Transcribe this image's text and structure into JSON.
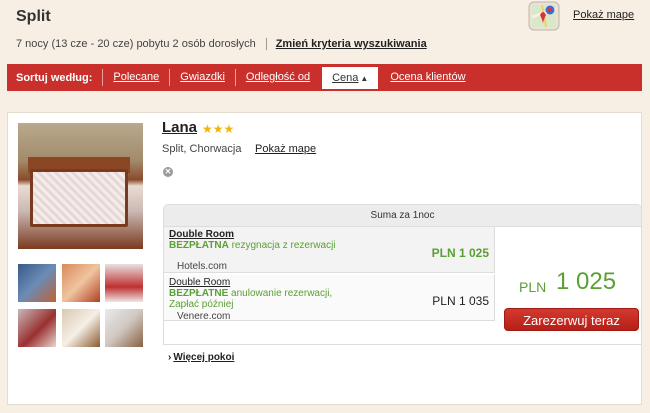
{
  "header": {
    "city": "Split",
    "map_link": "Pokaż mape",
    "search_summary": "7 nocy (13 cze - 20 cze) pobytu 2 osób dorosłych",
    "change_criteria": "Zmień kryteria wyszukiwania"
  },
  "sortbar": {
    "label": "Sortuj według:",
    "items": [
      {
        "label": "Polecane"
      },
      {
        "label": "Gwiazdki"
      },
      {
        "label": "Odległość od"
      },
      {
        "label": "Cena",
        "active": true
      },
      {
        "label": "Ocena klientów"
      }
    ]
  },
  "hotel": {
    "name": "Lana",
    "stars": "★★★",
    "star_count": 3,
    "location": "Split, Chorwacja",
    "map_link": "Pokaż mape",
    "price_header": "Suma za 1noc",
    "offers": [
      {
        "room": "Double Room",
        "note_bold": "BEZPŁATNA",
        "note_rest": " rezygnacja z rezerwacji",
        "provider": "Hotels.com",
        "price": "PLN 1 025"
      },
      {
        "room": "Double Room",
        "note_bold": "BEZPŁATNE",
        "note_rest": " anulowanie rezerwacji, Zapłać później",
        "provider": "Venere.com",
        "price": "PLN 1 035"
      }
    ],
    "best_currency": "PLN",
    "best_price": "1 025",
    "book_button": "Zarezerwuj teraz",
    "more_rooms": "Więcej pokoi"
  },
  "colors": {
    "accent_red": "#c9302c",
    "price_green": "#5ba033",
    "star_gold": "#f2b705"
  }
}
